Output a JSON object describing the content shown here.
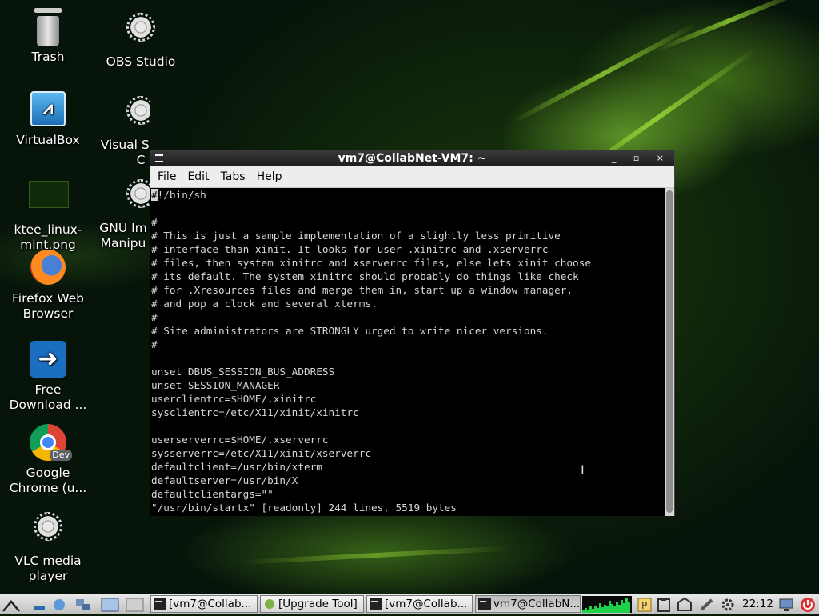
{
  "desktop": {
    "icons": [
      {
        "label": "Trash",
        "icon": "trash-icon"
      },
      {
        "label": "OBS Studio",
        "icon": "gear-icon"
      },
      {
        "label": "VirtualBox",
        "icon": "virtualbox-icon"
      },
      {
        "label": "Visual Studio C",
        "icon": "gear-icon"
      },
      {
        "label": "ktee_linux-mint.png",
        "icon": "image-file-icon"
      },
      {
        "label": "GNU Im Manipu",
        "icon": "gear-icon"
      },
      {
        "label": "Firefox Web Browser",
        "icon": "firefox-icon"
      },
      {
        "label": "Free Download ...",
        "icon": "free-download-manager-icon"
      },
      {
        "label": "Google Chrome (u...",
        "icon": "chrome-dev-icon",
        "badge": "Dev"
      },
      {
        "label": "VLC media player",
        "icon": "gear-icon"
      }
    ]
  },
  "window": {
    "title": "vm7@CollabNet-VM7: ~",
    "controls": "_ ▫ ×",
    "menu": [
      "File",
      "Edit",
      "Tabs",
      "Help"
    ]
  },
  "terminal": {
    "cursor_char": "#",
    "lines": [
      "!/bin/sh",
      "",
      "#",
      "# This is just a sample implementation of a slightly less primitive",
      "# interface than xinit. It looks for user .xinitrc and .xserverrc",
      "# files, then system xinitrc and xserverrc files, else lets xinit choose",
      "# its default. The system xinitrc should probably do things like check",
      "# for .Xresources files and merge them in, start up a window manager,",
      "# and pop a clock and several xterms.",
      "#",
      "# Site administrators are STRONGLY urged to write nicer versions.",
      "#",
      "",
      "unset DBUS_SESSION_BUS_ADDRESS",
      "unset SESSION_MANAGER",
      "userclientrc=$HOME/.xinitrc",
      "sysclientrc=/etc/X11/xinit/xinitrc",
      "",
      "userserverrc=$HOME/.xserverrc",
      "sysserverrc=/etc/X11/xinit/xserverrc",
      "defaultclient=/usr/bin/xterm",
      "defaultserver=/usr/bin/X",
      "defaultclientargs=\"\"",
      "\"/usr/bin/startx\" [readonly] 244 lines, 5519 bytes"
    ]
  },
  "taskbar": {
    "tasks": [
      {
        "label": "[vm7@Collab...",
        "icon": "terminal-icon",
        "active": false
      },
      {
        "label": "[Upgrade Tool]",
        "icon": "upgrade-tool-icon",
        "active": false
      },
      {
        "label": "[vm7@Collab...",
        "icon": "terminal-icon",
        "active": false
      },
      {
        "label": "vm7@CollabN...",
        "icon": "terminal-icon",
        "active": true
      }
    ],
    "clock": "22:12"
  },
  "colors": {
    "terminal_bg": "#000000",
    "terminal_fg": "#d6d6d6",
    "activity_graph": "#1fd14a"
  }
}
